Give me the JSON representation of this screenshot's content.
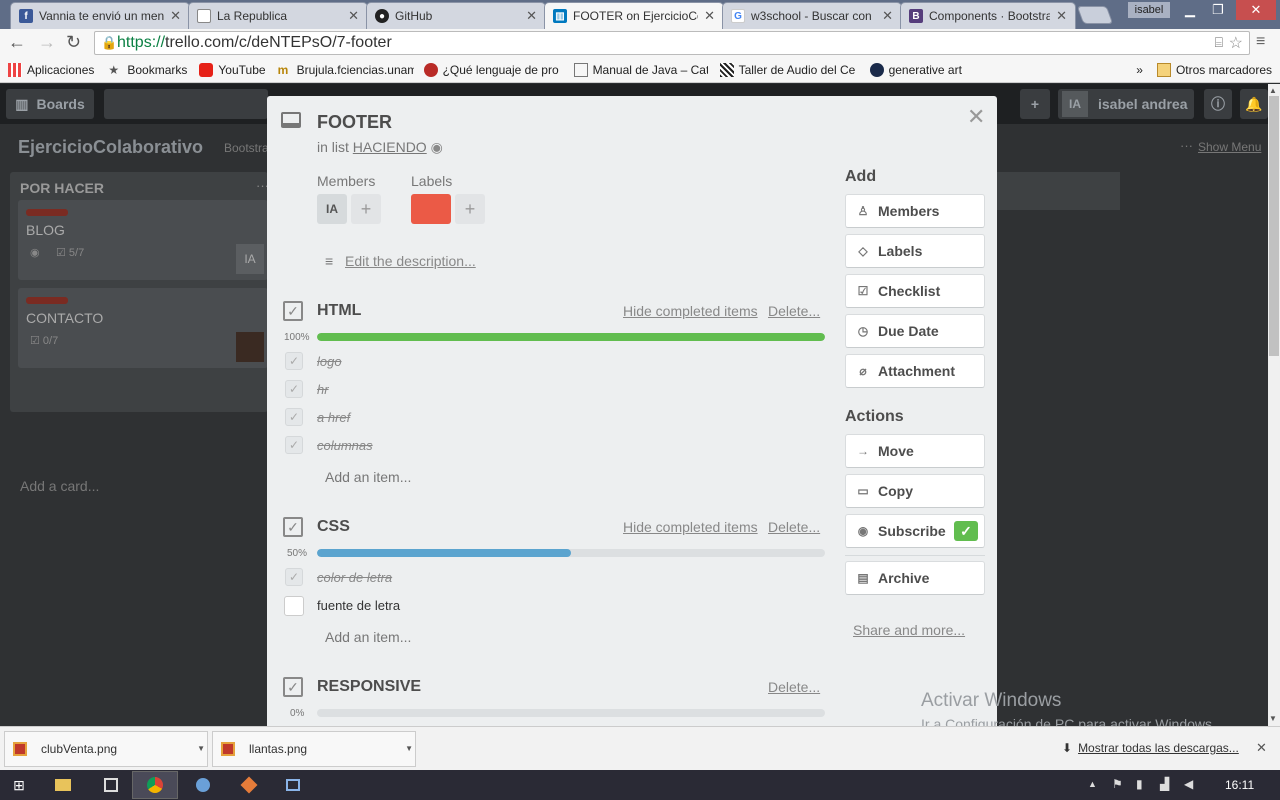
{
  "browser": {
    "tabs": [
      {
        "title": "Vannia te envió un mensaje",
        "favicon": "facebook-icon",
        "color": "#3b5998",
        "active": false
      },
      {
        "title": "La Republica",
        "favicon": "page-icon",
        "color": "#ffffff",
        "active": false
      },
      {
        "title": "GitHub",
        "favicon": "github-icon",
        "color": "#222222",
        "active": false
      },
      {
        "title": "FOOTER on EjercicioCo",
        "favicon": "trello-icon",
        "color": "#0079bf",
        "active": true
      },
      {
        "title": "w3school - Buscar con",
        "favicon": "google-icon",
        "color": "#4285f4",
        "active": false
      },
      {
        "title": "Components · Bootstra",
        "favicon": "bootstrap-icon",
        "color": "#563d7c",
        "active": false
      }
    ],
    "user_badge": "isabel",
    "url_https": "https://",
    "url_rest": "trello.com/c/deNTEPsO/7-footer",
    "bookmarks": [
      {
        "label": "Aplicaciones",
        "icon": "apps-grid-icon"
      },
      {
        "label": "Bookmarks",
        "icon": "star-icon"
      },
      {
        "label": "YouTube",
        "icon": "youtube-icon"
      },
      {
        "label": "Brujula.fciencias.unam",
        "icon": "brujula-icon"
      },
      {
        "label": "¿Qué lenguaje de pro",
        "icon": "quora-icon"
      },
      {
        "label": "Manual de Java – Cate",
        "icon": "page-icon"
      },
      {
        "label": "Taller de Audio del Ce",
        "icon": "audio-icon"
      },
      {
        "label": "generative art",
        "icon": "s-icon"
      }
    ],
    "other_bookmarks": "Otros marcadores"
  },
  "trello": {
    "header": {
      "boards": "Boards",
      "user_initials": "IA",
      "user_name": "isabel andrea"
    },
    "board_title": "EjercicioColaborativo",
    "board_team": "Bootstra",
    "show_menu": "Show Menu",
    "list": {
      "title": "POR HACER",
      "cards": [
        {
          "title": "BLOG",
          "checklist": "5/7",
          "member": "IA"
        },
        {
          "title": "CONTACTO",
          "checklist": "0/7"
        }
      ],
      "add_card": "Add a card..."
    }
  },
  "card": {
    "title": "FOOTER",
    "in_list_prefix": "in list",
    "list_name": "HACIENDO",
    "members_label": "Members",
    "labels_label": "Labels",
    "member_initials": "IA",
    "label_color": "#eb5a46",
    "edit_description": "Edit the description...",
    "checklists": [
      {
        "title": "HTML",
        "hide_link": "Hide completed items",
        "delete_link": "Delete...",
        "percent_text": "100%",
        "progress": 1.0,
        "color": "#61bd4f",
        "items": [
          {
            "text": "logo",
            "done": true
          },
          {
            "text": "hr",
            "done": true
          },
          {
            "text": "a href",
            "done": true
          },
          {
            "text": "columnas",
            "done": true
          }
        ],
        "add_item": "Add an item..."
      },
      {
        "title": "CSS",
        "hide_link": "Hide completed items",
        "delete_link": "Delete...",
        "percent_text": "50%",
        "progress": 0.5,
        "color": "#5ba4cf",
        "items": [
          {
            "text": "color de letra",
            "done": true
          },
          {
            "text": "fuente de letra",
            "done": false
          }
        ],
        "add_item": "Add an item..."
      },
      {
        "title": "RESPONSIVE",
        "delete_link": "Delete...",
        "percent_text": "0%",
        "progress": 0.0,
        "color": "#5ba4cf",
        "items": []
      }
    ],
    "sidebar": {
      "add_heading": "Add",
      "add_buttons": [
        {
          "label": "Members",
          "icon": "person-icon"
        },
        {
          "label": "Labels",
          "icon": "tag-icon"
        },
        {
          "label": "Checklist",
          "icon": "checklist-icon"
        },
        {
          "label": "Due Date",
          "icon": "clock-icon"
        },
        {
          "label": "Attachment",
          "icon": "paperclip-icon"
        }
      ],
      "actions_heading": "Actions",
      "action_buttons": [
        {
          "label": "Move",
          "icon": "arrow-right-icon"
        },
        {
          "label": "Copy",
          "icon": "card-icon"
        },
        {
          "label": "Subscribe",
          "icon": "eye-icon"
        },
        {
          "label": "Archive",
          "icon": "archive-icon"
        }
      ],
      "share_more": "Share and more..."
    }
  },
  "watermark": {
    "line1": "Activar Windows",
    "line2": "Ir a Configuración de PC para activar Windows."
  },
  "downloads": {
    "files": [
      {
        "name": "clubVenta.png"
      },
      {
        "name": "llantas.png"
      }
    ],
    "show_all": "Mostrar todas las descargas..."
  },
  "taskbar": {
    "time": "16:11"
  }
}
